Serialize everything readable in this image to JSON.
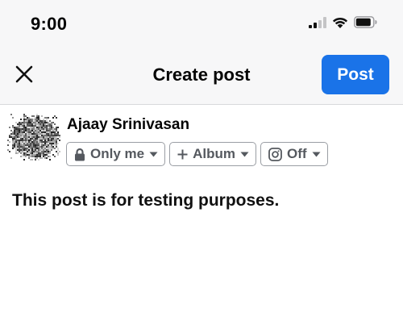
{
  "status_bar": {
    "time": "9:00",
    "icons": [
      "cellular-signal-icon",
      "wifi-icon",
      "battery-icon"
    ]
  },
  "nav": {
    "title": "Create post",
    "close_icon": "close-icon",
    "post_label": "Post"
  },
  "author": {
    "name": "Ajaay Srinivasan"
  },
  "chips": {
    "audience": {
      "icon": "lock-icon",
      "label": "Only me",
      "trailing_icon": "caret-down-icon"
    },
    "album": {
      "icon": "plus-icon",
      "label": "Album",
      "trailing_icon": "caret-down-icon"
    },
    "instagram": {
      "icon": "instagram-icon",
      "label": "Off",
      "trailing_icon": "caret-down-icon"
    }
  },
  "post": {
    "text": "This post is for testing purposes."
  },
  "colors": {
    "header_bg": "#f7f7f8",
    "post_button": "#1a73e8",
    "chip_text": "#55595f",
    "chip_border": "#9a9ea4"
  }
}
